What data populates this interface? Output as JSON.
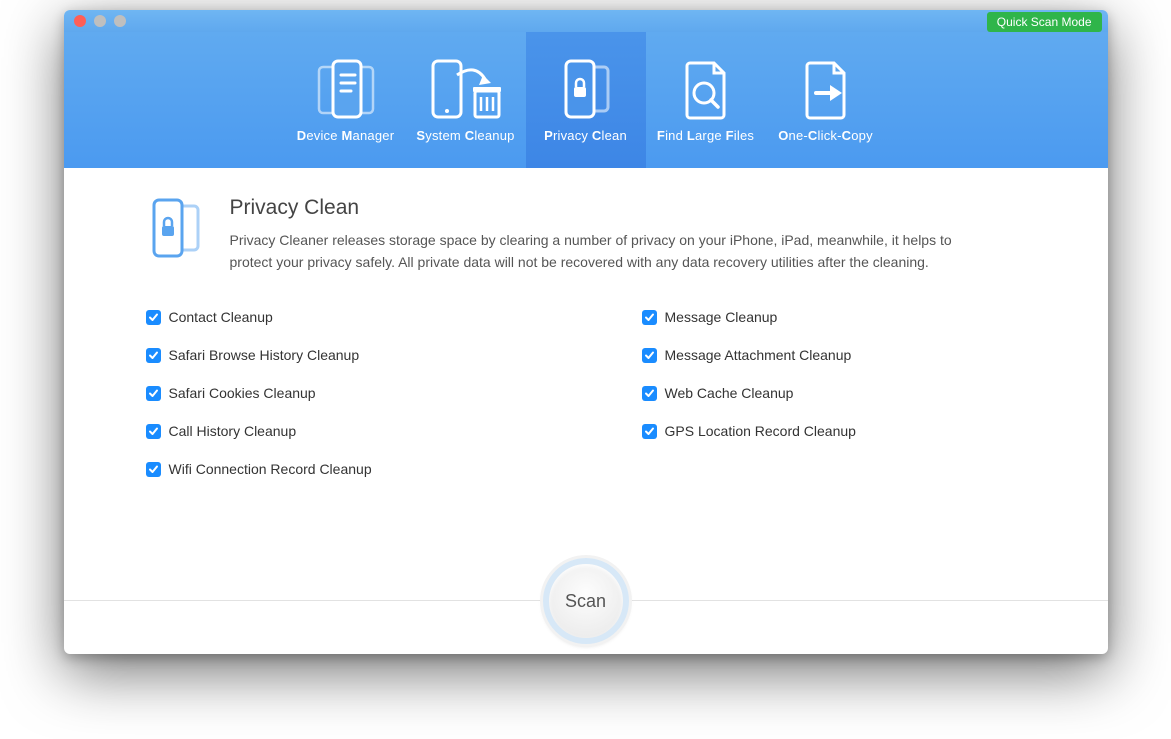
{
  "quick_mode_label": "Quick Scan Mode",
  "nav": [
    {
      "id": "device-manager",
      "label_parts": [
        "D",
        "evice ",
        "M",
        "anager"
      ]
    },
    {
      "id": "system-cleanup",
      "label_parts": [
        "S",
        "ystem ",
        "C",
        "leanup"
      ]
    },
    {
      "id": "privacy-clean",
      "label_parts": [
        "P",
        "rivacy ",
        "C",
        "lean"
      ],
      "active": true
    },
    {
      "id": "find-large-files",
      "label_parts": [
        "F",
        "ind ",
        "L",
        "arge ",
        "F",
        "iles"
      ]
    },
    {
      "id": "one-click-copy",
      "label_parts": [
        "O",
        "ne-",
        "C",
        "lick-",
        "C",
        "opy"
      ]
    }
  ],
  "page": {
    "title": "Privacy Clean",
    "description": "Privacy Cleaner releases storage space by clearing a number of privacy on your iPhone, iPad, meanwhile, it helps to protect your privacy safely. All private data will not be recovered with any data recovery utilities after the cleaning."
  },
  "options_left": [
    "Contact Cleanup",
    "Safari Browse History Cleanup",
    "Safari Cookies Cleanup",
    "Call History Cleanup",
    "Wifi Connection Record Cleanup"
  ],
  "options_right": [
    "Message Cleanup",
    "Message Attachment Cleanup",
    "Web Cache Cleanup",
    "GPS Location Record Cleanup"
  ],
  "scan_label": "Scan"
}
